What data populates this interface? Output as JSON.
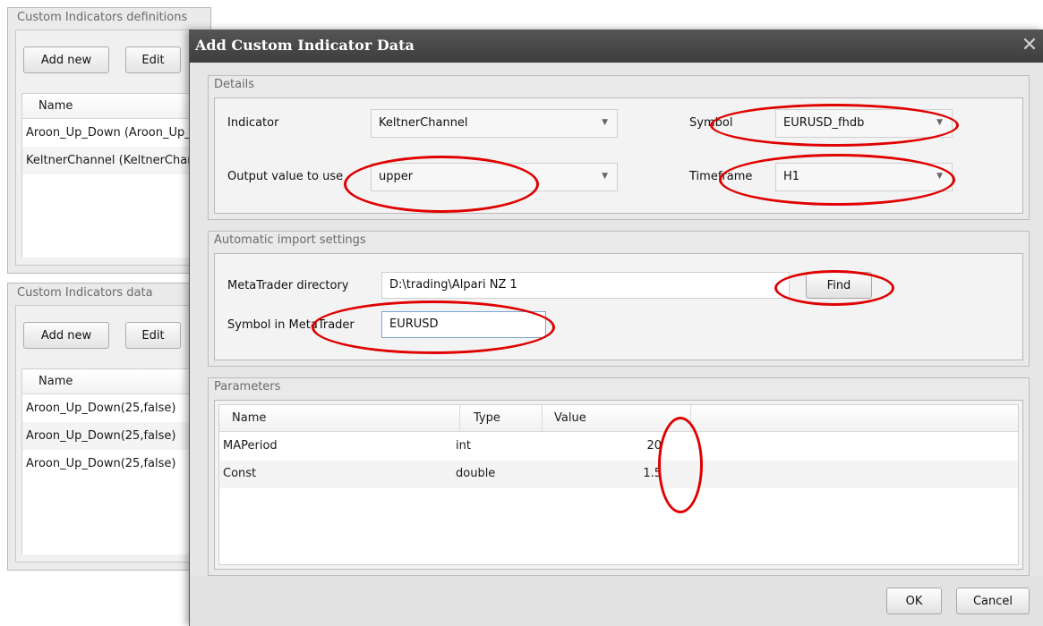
{
  "definitions_panel": {
    "title": "Custom Indicators definitions",
    "add_new_label": "Add new",
    "edit_label": "Edit",
    "column_name": "Name",
    "rows": [
      "Aroon_Up_Down (Aroon_Up_Down)",
      "KeltnerChannel (KeltnerChannel)"
    ]
  },
  "data_panel": {
    "title": "Custom Indicators data",
    "add_new_label": "Add new",
    "edit_label": "Edit",
    "column_name": "Name",
    "rows": [
      "Aroon_Up_Down(25,false)",
      "Aroon_Up_Down(25,false)",
      "Aroon_Up_Down(25,false)"
    ]
  },
  "dialog": {
    "title": "Add Custom Indicator Data",
    "close_glyph": "✕",
    "details": {
      "title": "Details",
      "indicator_label": "Indicator",
      "indicator_value": "KeltnerChannel",
      "symbol_label": "Symbol",
      "symbol_value": "EURUSD_fhdb",
      "output_label": "Output value to use",
      "output_value": "upper",
      "timeframe_label": "Timeframe",
      "timeframe_value": "H1"
    },
    "import": {
      "title": "Automatic import settings",
      "directory_label": "MetaTrader directory",
      "directory_value": "D:\\trading\\Alpari NZ 1",
      "find_label": "Find",
      "symbol_mt_label": "Symbol in MetaTrader",
      "symbol_mt_value": "EURUSD"
    },
    "parameters": {
      "title": "Parameters",
      "columns": [
        "Name",
        "Type",
        "Value"
      ],
      "rows": [
        {
          "name": "MAPeriod",
          "type": "int",
          "value": "20"
        },
        {
          "name": "Const",
          "type": "double",
          "value": "1.5"
        }
      ]
    },
    "ok_label": "OK",
    "cancel_label": "Cancel"
  },
  "colors": {
    "annotation_ring": "#e00000",
    "title_bar": "#464646"
  },
  "icons": {
    "dropdown": "chevron-down-icon",
    "close": "close-icon"
  }
}
